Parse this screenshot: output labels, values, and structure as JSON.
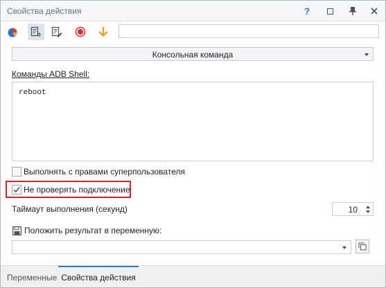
{
  "window": {
    "title": "Свойства действия",
    "controls": {
      "help": "?"
    }
  },
  "toolbar": {
    "icons": [
      "play-pie-icon",
      "action-props-icon",
      "edit-list-icon",
      "record-icon",
      "arrow-down-icon"
    ],
    "path_value": ""
  },
  "action": {
    "type_dropdown": "Консольная команда",
    "commands_label": "Команды ADB Shell:",
    "commands_value": "reboot",
    "superuser": {
      "label": "Выполнять с правами суперпользователя",
      "checked": false
    },
    "no_check_connection": {
      "label": "Не проверять подключение",
      "checked": true,
      "highlight_color": "#d3202f"
    },
    "timeout": {
      "label": "Таймаут выполнения (секунд)",
      "value": "10"
    },
    "save_result": {
      "label": "Положить результат в переменную:",
      "value": ""
    }
  },
  "tabs": [
    {
      "label": "Переменные",
      "active": false
    },
    {
      "label": "Свойства действия",
      "active": true
    }
  ],
  "colors": {
    "accent": "#2b7cd3",
    "record": "#e0282e",
    "arrow": "#f0a020"
  }
}
